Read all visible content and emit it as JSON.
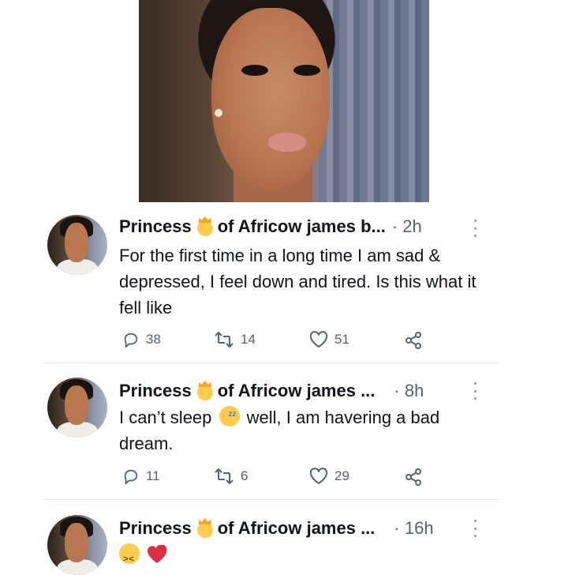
{
  "tweets": [
    {
      "name": "Princess",
      "name_suffix": "of Africow james b...",
      "time": "· 2h",
      "text": "For the first time in a long time I am sad & depressed, I feel down and tired. Is this what it fell like",
      "replies": "38",
      "retweets": "14",
      "likes": "51"
    },
    {
      "name": "Princess",
      "name_suffix": "of Africow james ...",
      "time": "· 8h",
      "text_a": "I can’t sleep",
      "text_b": "well, I am havering a bad dream.",
      "replies": "11",
      "retweets": "6",
      "likes": "29"
    },
    {
      "name": "Princess",
      "name_suffix": "of Africow james ...",
      "time": "· 16h"
    }
  ],
  "icons": {
    "crown_emoji": "princess-emoji",
    "sleepy_emoji": "sleeping-face-emoji",
    "confounded_emoji": "confounded-face-emoji",
    "broken_heart_emoji": "broken-heart-emoji",
    "reply": "reply-icon",
    "retweet": "retweet-icon",
    "like": "heart-icon",
    "share": "share-icon",
    "more": "more-icon"
  },
  "colors": {
    "text": "#0f1419",
    "muted": "#536471",
    "divider": "#e6e9ec"
  }
}
